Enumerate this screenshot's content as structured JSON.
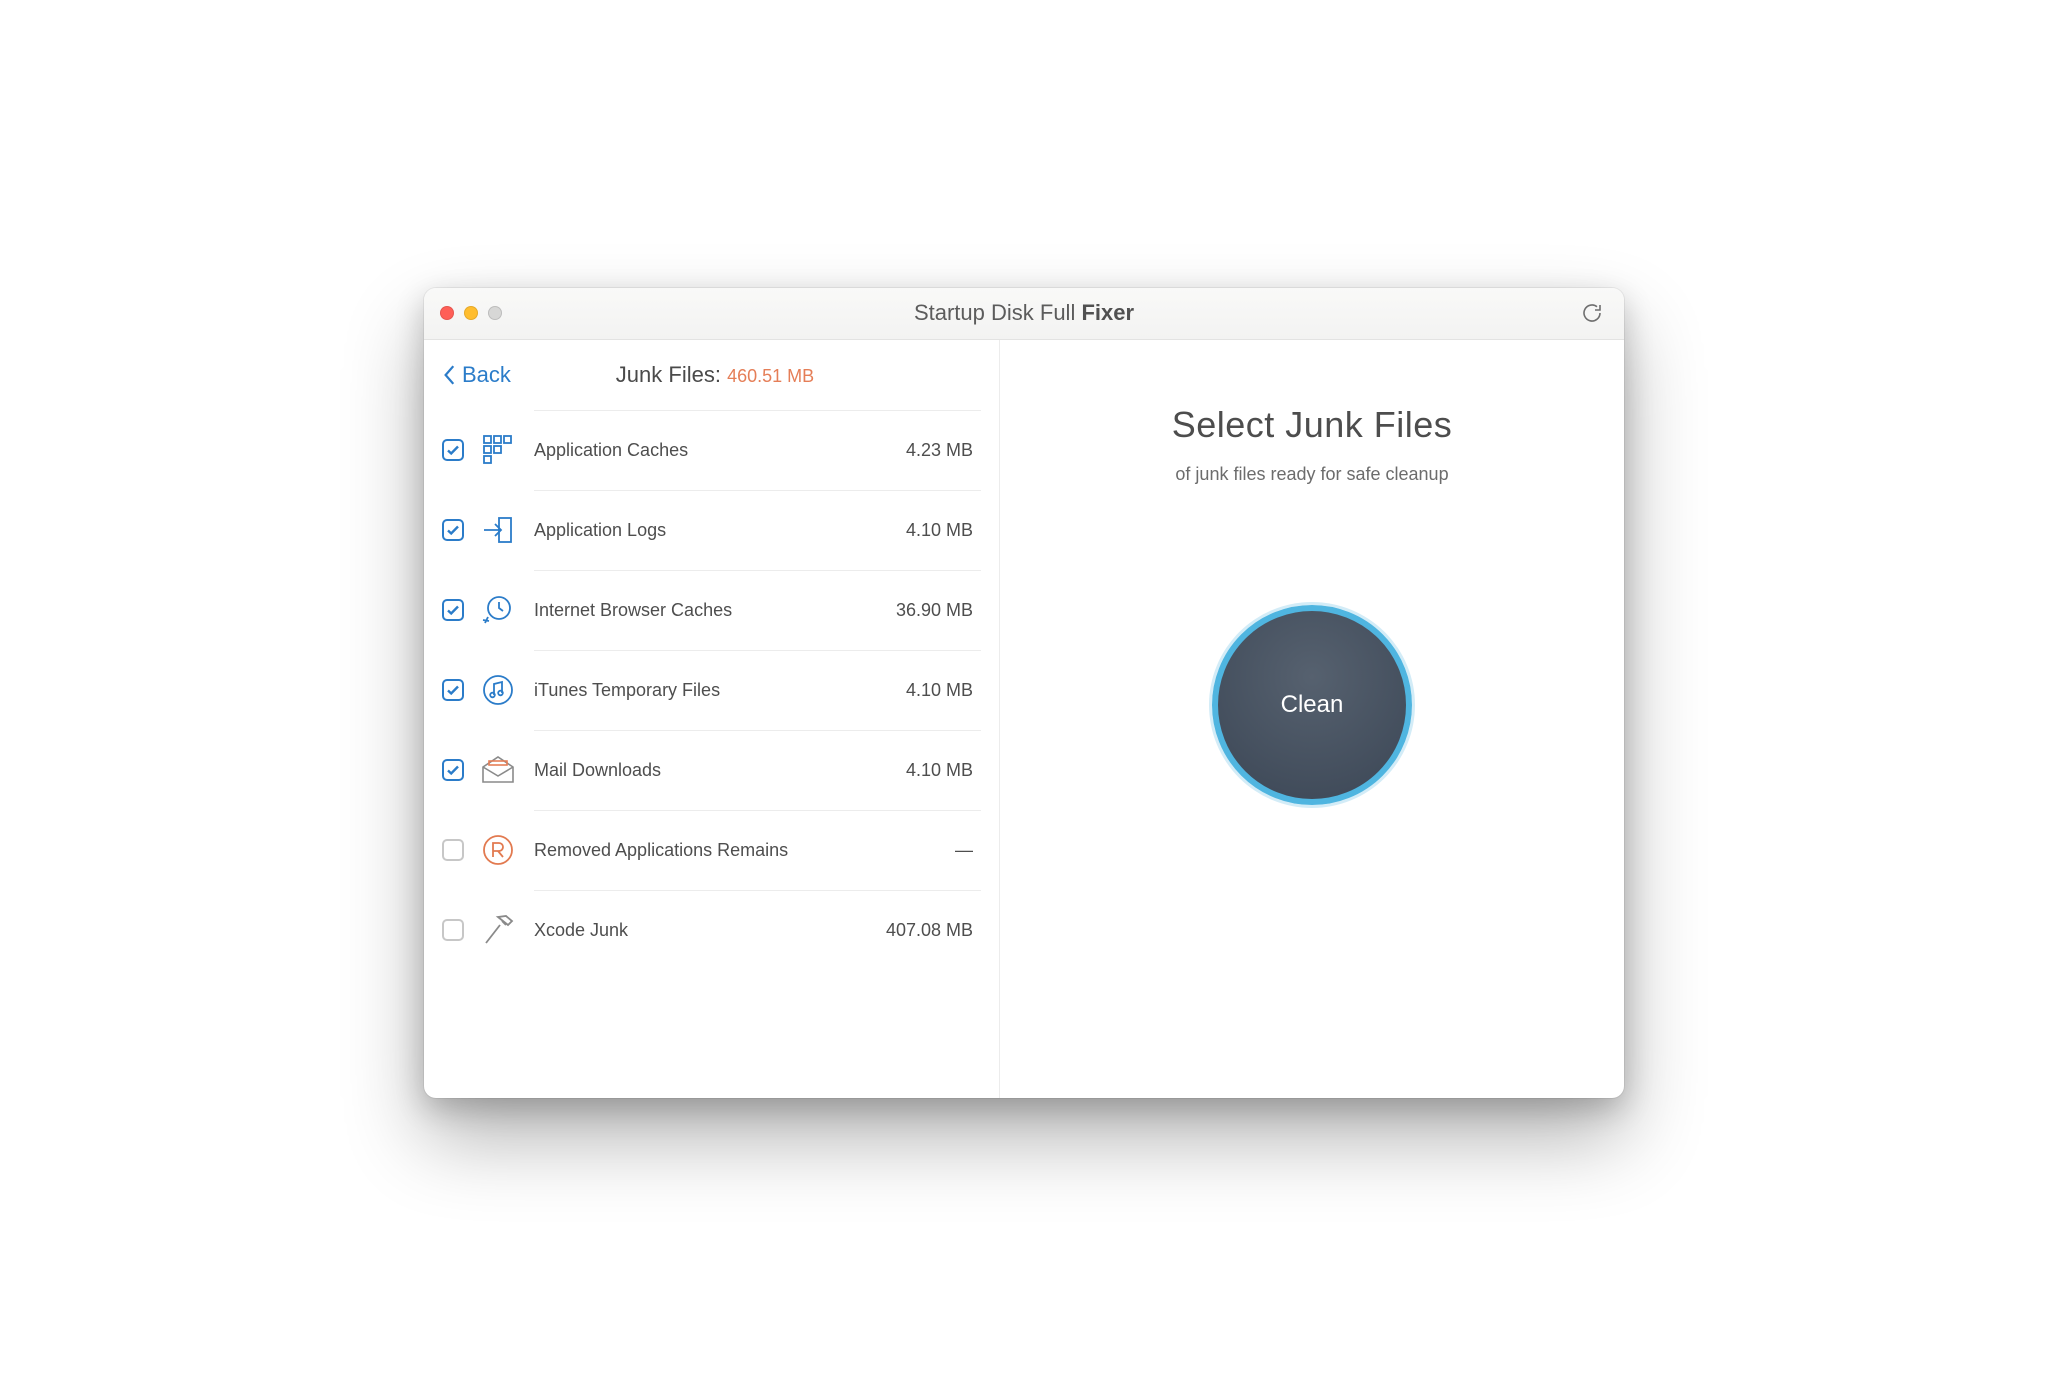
{
  "window": {
    "title_prefix": "Startup Disk Full ",
    "title_bold": "Fixer"
  },
  "back_label": "Back",
  "junk": {
    "label": "Junk Files: ",
    "size": "460.51 MB"
  },
  "right": {
    "title": "Select Junk Files",
    "subtitle": "of junk files ready for safe cleanup",
    "button": "Clean"
  },
  "items": [
    {
      "name": "Application Caches",
      "size": "4.23 MB",
      "checked": true,
      "icon": "grid-icon"
    },
    {
      "name": "Application Logs",
      "size": "4.10 MB",
      "checked": true,
      "icon": "log-arrow-icon"
    },
    {
      "name": "Internet Browser Caches",
      "size": "36.90 MB",
      "checked": true,
      "icon": "browser-refresh-icon"
    },
    {
      "name": "iTunes Temporary Files",
      "size": "4.10 MB",
      "checked": true,
      "icon": "music-note-icon"
    },
    {
      "name": "Mail Downloads",
      "size": "4.10 MB",
      "checked": true,
      "icon": "mail-icon"
    },
    {
      "name": "Removed Applications Remains",
      "size": "—",
      "checked": false,
      "icon": "removed-app-icon"
    },
    {
      "name": "Xcode Junk",
      "size": "407.08 MB",
      "checked": false,
      "icon": "hammer-icon"
    }
  ]
}
